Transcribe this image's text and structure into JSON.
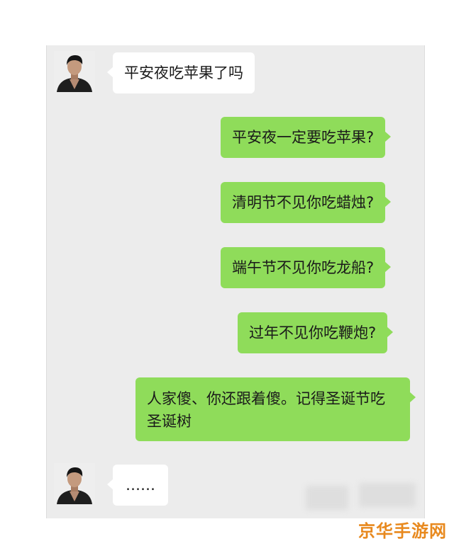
{
  "chat": {
    "messages": [
      {
        "side": "in",
        "text": "平安夜吃苹果了吗"
      },
      {
        "side": "out",
        "text": "平安夜一定要吃苹果?"
      },
      {
        "side": "out",
        "text": "清明节不见你吃蜡烛?"
      },
      {
        "side": "out",
        "text": "端午节不见你吃龙船?"
      },
      {
        "side": "out",
        "text": "过年不见你吃鞭炮?"
      },
      {
        "side": "out",
        "text": "人家傻、你还跟着傻。记得圣诞节吃圣诞树"
      },
      {
        "side": "in",
        "text": "……"
      }
    ]
  },
  "colors": {
    "chat_background": "#ececec",
    "incoming_bubble": "#ffffff",
    "outgoing_bubble": "#8fdc5a",
    "watermark": "#e8891e"
  },
  "watermark": {
    "text": "京华手游网"
  }
}
